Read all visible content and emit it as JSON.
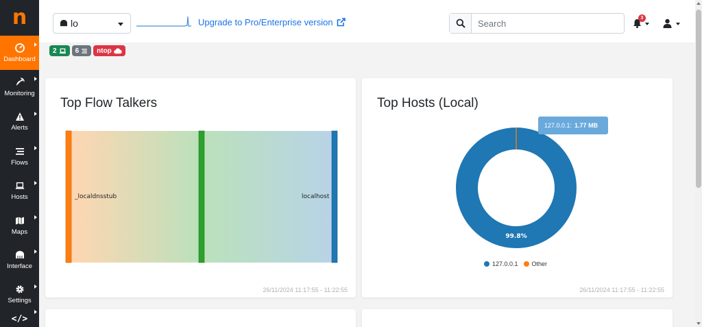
{
  "app": {
    "logo_letter": "n"
  },
  "sidebar": {
    "items": [
      {
        "label": "Dashboard",
        "icon": "gauge-icon",
        "active": true
      },
      {
        "label": "Monitoring",
        "icon": "satellite-dish-icon"
      },
      {
        "label": "Alerts",
        "icon": "warning-triangle-icon"
      },
      {
        "label": "Flows",
        "icon": "stream-lines-icon"
      },
      {
        "label": "Hosts",
        "icon": "laptop-icon"
      },
      {
        "label": "Maps",
        "icon": "map-icon"
      },
      {
        "label": "Interface",
        "icon": "ethernet-icon"
      },
      {
        "label": "Settings",
        "icon": "gear-icon"
      }
    ],
    "developer_icon": "</>"
  },
  "header": {
    "interface_value": "lo",
    "upgrade_link": "Upgrade to Pro/Enterprise version",
    "search_placeholder": "Search",
    "alert_count": "3"
  },
  "badges": {
    "hosts_count": "2",
    "flows_count": "6",
    "cloud_label": "ntop"
  },
  "cards": {
    "flow_talkers": {
      "title": "Top Flow Talkers",
      "timestamp": "26/11/2024 11:17:55 - 11:22:55",
      "source_label": "_localdnsstub",
      "target_label": "localhost"
    },
    "top_hosts": {
      "title": "Top Hosts (Local)",
      "timestamp": "26/11/2024 11:17:55 - 11:22:55",
      "tooltip_host": "127.0.0.1:",
      "tooltip_value": "1.77 MB",
      "slice_label": "99.8%",
      "legend": [
        {
          "label": "127.0.0.1",
          "color": "#1f77b4"
        },
        {
          "label": "Other",
          "color": "#ff7f0e"
        }
      ]
    }
  },
  "chart_data": [
    {
      "type": "sankey",
      "title": "Top Flow Talkers",
      "nodes": [
        "_localdnsstub",
        "localhost"
      ],
      "node_colors": [
        "#ff7f0e",
        "#2ca02c",
        "#1f77b4"
      ]
    },
    {
      "type": "pie",
      "title": "Top Hosts (Local)",
      "labels": [
        "127.0.0.1",
        "Other"
      ],
      "values": [
        99.8,
        0.2
      ],
      "colors": [
        "#1f77b4",
        "#ff7f0e"
      ],
      "donut": true,
      "tooltip": "127.0.0.1: 1.77 MB",
      "legend_position": "bottom"
    }
  ],
  "colors": {
    "brand": "#ff7500",
    "sidebar_bg": "#212529",
    "link": "#1a73e8"
  }
}
